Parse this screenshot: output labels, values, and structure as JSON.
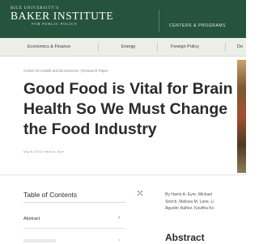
{
  "header": {
    "logo_small": "RICE UNIVERSITY'S",
    "logo_main": "BAKER INSTITUTE",
    "logo_sub": "FOR PUBLIC POLICY",
    "centers_link": "CENTERS & PROGRAMS"
  },
  "nav": {
    "items": [
      "Economics & Finance",
      "Energy",
      "Foreign Policy",
      "Do"
    ]
  },
  "article": {
    "eyebrow": "Center for Health and Biosciences | Research Paper",
    "title": "Good Food is Vital for Brain Health So We Must Change the Food Industry",
    "meta": "May 8, 2023 | Harris A. Eyre",
    "authors_lines": [
      "By Harris A. Eyre, Michael",
      "Storch, Melissa M. Lane, Li",
      "Agustín Ibáñez, Kavitha Ko"
    ],
    "abstract_heading": "Abstract"
  },
  "toc": {
    "title": "Table of Contents",
    "items": [
      "Abstract"
    ]
  },
  "icons": {
    "collapse": "collapse-icon",
    "chevron": "chevron-right-icon"
  },
  "colors": {
    "header_green": "#25533b",
    "nav_bg": "#ecefe8"
  }
}
